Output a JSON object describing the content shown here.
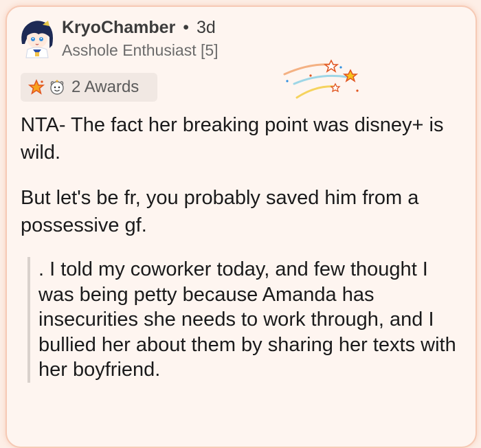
{
  "comment": {
    "username": "KryoChamber",
    "separator": "•",
    "age": "3d",
    "flair": "Asshole Enthusiast [5]",
    "awards_label": "2 Awards",
    "paragraphs": [
      "NTA- The fact her breaking point was disney+ is wild.",
      "But let's be fr, you probably saved him from a possessive gf."
    ],
    "quote": ". I told my coworker today, and few thought I was being petty because Amanda has insecurities she needs to work through, and I bullied her about them by sharing her texts with her boyfriend."
  },
  "icons": {
    "avatar": "snoo-avatar",
    "award_1": "star-award-icon",
    "award_2": "wholesome-award-icon",
    "decoration": "shooting-stars-icon"
  },
  "colors": {
    "background": "#fdeee6",
    "card": "#fef5f0",
    "card_border": "#f6c9b4",
    "award_pill": "#f1e8e3",
    "quote_bar": "#d9d1cc"
  }
}
